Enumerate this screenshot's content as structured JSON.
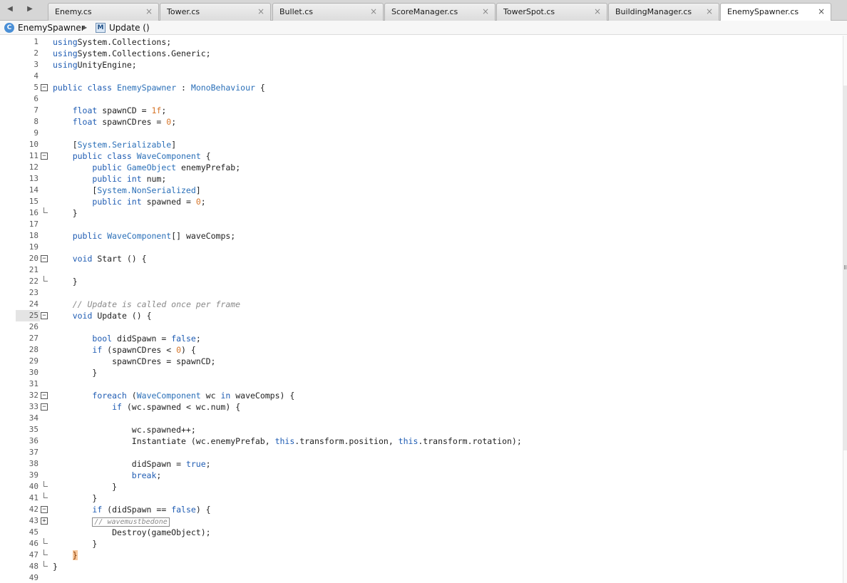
{
  "tabs": [
    {
      "label": "Enemy.cs",
      "close": "×"
    },
    {
      "label": "Tower.cs",
      "close": "×"
    },
    {
      "label": "Bullet.cs",
      "close": "×"
    },
    {
      "label": "ScoreManager.cs",
      "close": "×"
    },
    {
      "label": "TowerSpot.cs",
      "close": "×"
    },
    {
      "label": "BuildingManager.cs",
      "close": "×"
    },
    {
      "label": "EnemySpawner.cs",
      "close": "×"
    }
  ],
  "active_tab_index": 6,
  "nav": {
    "back_icon": "◀",
    "forward_icon": "▶",
    "class_name": "EnemySpawner",
    "class_icon": "C",
    "separator": "▶",
    "method_icon": "M",
    "method_name": "Update ()"
  },
  "editor": {
    "current_line": 25,
    "lines": [
      {
        "n": "1",
        "fold": "",
        "tokens": [
          [
            "kw",
            "using"
          ],
          [
            "",
            "System.Collections;"
          ]
        ]
      },
      {
        "n": "2",
        "fold": "",
        "tokens": [
          [
            "kw",
            "using"
          ],
          [
            "",
            "System.Collections.Generic;"
          ]
        ]
      },
      {
        "n": "3",
        "fold": "",
        "tokens": [
          [
            "kw",
            "using"
          ],
          [
            "",
            "UnityEngine;"
          ]
        ]
      },
      {
        "n": "4",
        "fold": "",
        "tokens": []
      },
      {
        "n": "5",
        "fold": "open",
        "tokens": [
          [
            "kw",
            "public class"
          ],
          [
            "",
            " "
          ],
          [
            "ty",
            "EnemySpawner"
          ],
          [
            "",
            " : "
          ],
          [
            "ty",
            "MonoBehaviour"
          ],
          [
            "",
            " {"
          ]
        ]
      },
      {
        "n": "6",
        "fold": "",
        "tokens": []
      },
      {
        "n": "7",
        "fold": "",
        "tokens": [
          [
            "",
            "    "
          ],
          [
            "kw",
            "float"
          ],
          [
            "",
            " spawnCD = "
          ],
          [
            "num",
            "1f"
          ],
          [
            "",
            ";"
          ]
        ]
      },
      {
        "n": "8",
        "fold": "",
        "tokens": [
          [
            "",
            "    "
          ],
          [
            "kw",
            "float"
          ],
          [
            "",
            " spawnCDres = "
          ],
          [
            "num",
            "0"
          ],
          [
            "",
            ";"
          ]
        ]
      },
      {
        "n": "9",
        "fold": "",
        "tokens": []
      },
      {
        "n": "10",
        "fold": "",
        "tokens": [
          [
            "",
            "    ["
          ],
          [
            "ty",
            "System.Serializable"
          ],
          [
            "",
            "]"
          ]
        ]
      },
      {
        "n": "11",
        "fold": "open",
        "tokens": [
          [
            "",
            "    "
          ],
          [
            "kw",
            "public class"
          ],
          [
            "",
            " "
          ],
          [
            "ty",
            "WaveComponent"
          ],
          [
            "",
            " {"
          ]
        ]
      },
      {
        "n": "12",
        "fold": "",
        "tokens": [
          [
            "",
            "        "
          ],
          [
            "kw",
            "public"
          ],
          [
            "",
            " "
          ],
          [
            "ty",
            "GameObject"
          ],
          [
            "",
            " enemyPrefab;"
          ]
        ]
      },
      {
        "n": "13",
        "fold": "",
        "tokens": [
          [
            "",
            "        "
          ],
          [
            "kw",
            "public int"
          ],
          [
            "",
            " num;"
          ]
        ]
      },
      {
        "n": "14",
        "fold": "",
        "tokens": [
          [
            "",
            "        ["
          ],
          [
            "ty",
            "System.NonSerialized"
          ],
          [
            "",
            "]"
          ]
        ]
      },
      {
        "n": "15",
        "fold": "",
        "tokens": [
          [
            "",
            "        "
          ],
          [
            "kw",
            "public int"
          ],
          [
            "",
            " spawned = "
          ],
          [
            "num",
            "0"
          ],
          [
            "",
            ";"
          ]
        ]
      },
      {
        "n": "16",
        "fold": "end",
        "tokens": [
          [
            "",
            "    }"
          ]
        ]
      },
      {
        "n": "17",
        "fold": "",
        "tokens": []
      },
      {
        "n": "18",
        "fold": "",
        "tokens": [
          [
            "",
            "    "
          ],
          [
            "kw",
            "public"
          ],
          [
            "",
            " "
          ],
          [
            "ty",
            "WaveComponent"
          ],
          [
            "",
            "[] waveComps;"
          ]
        ]
      },
      {
        "n": "19",
        "fold": "",
        "tokens": []
      },
      {
        "n": "20",
        "fold": "open",
        "tokens": [
          [
            "",
            "    "
          ],
          [
            "kw",
            "void"
          ],
          [
            "",
            " Start () {"
          ]
        ]
      },
      {
        "n": "21",
        "fold": "",
        "tokens": []
      },
      {
        "n": "22",
        "fold": "end",
        "tokens": [
          [
            "",
            "    }"
          ]
        ]
      },
      {
        "n": "23",
        "fold": "",
        "tokens": []
      },
      {
        "n": "24",
        "fold": "",
        "tokens": [
          [
            "",
            "    "
          ],
          [
            "cm",
            "// Update is called once per frame"
          ]
        ]
      },
      {
        "n": "25",
        "fold": "open",
        "tokens": [
          [
            "",
            "    "
          ],
          [
            "kw",
            "void"
          ],
          [
            "",
            " Update () {"
          ]
        ]
      },
      {
        "n": "26",
        "fold": "",
        "tokens": []
      },
      {
        "n": "27",
        "fold": "",
        "tokens": [
          [
            "",
            "        "
          ],
          [
            "kw",
            "bool"
          ],
          [
            "",
            " didSpawn = "
          ],
          [
            "kw",
            "false"
          ],
          [
            "",
            ";"
          ]
        ]
      },
      {
        "n": "28",
        "fold": "",
        "tokens": [
          [
            "",
            "        "
          ],
          [
            "kw",
            "if"
          ],
          [
            "",
            " (spawnCDres < "
          ],
          [
            "num",
            "0"
          ],
          [
            "",
            ") {"
          ]
        ]
      },
      {
        "n": "29",
        "fold": "",
        "tokens": [
          [
            "",
            "            spawnCDres = spawnCD;"
          ]
        ]
      },
      {
        "n": "30",
        "fold": "",
        "tokens": [
          [
            "",
            "        }"
          ]
        ]
      },
      {
        "n": "31",
        "fold": "",
        "tokens": []
      },
      {
        "n": "32",
        "fold": "open",
        "tokens": [
          [
            "",
            "        "
          ],
          [
            "kw",
            "foreach"
          ],
          [
            "",
            " ("
          ],
          [
            "ty",
            "WaveComponent"
          ],
          [
            "",
            " wc "
          ],
          [
            "kw",
            "in"
          ],
          [
            "",
            " waveComps) {"
          ]
        ]
      },
      {
        "n": "33",
        "fold": "open",
        "tokens": [
          [
            "",
            "            "
          ],
          [
            "kw",
            "if"
          ],
          [
            "",
            " (wc.spawned < wc.num) {"
          ]
        ]
      },
      {
        "n": "34",
        "fold": "",
        "tokens": []
      },
      {
        "n": "35",
        "fold": "",
        "tokens": [
          [
            "",
            "                wc.spawned++;"
          ]
        ]
      },
      {
        "n": "36",
        "fold": "",
        "tokens": [
          [
            "",
            "                Instantiate (wc.enemyPrefab, "
          ],
          [
            "kw",
            "this"
          ],
          [
            "",
            ".transform.position, "
          ],
          [
            "kw",
            "this"
          ],
          [
            "",
            ".transform.rotation);"
          ]
        ]
      },
      {
        "n": "37",
        "fold": "",
        "tokens": []
      },
      {
        "n": "38",
        "fold": "",
        "tokens": [
          [
            "",
            "                didSpawn = "
          ],
          [
            "kw",
            "true"
          ],
          [
            "",
            ";"
          ]
        ]
      },
      {
        "n": "39",
        "fold": "",
        "tokens": [
          [
            "",
            "                "
          ],
          [
            "kw",
            "break"
          ],
          [
            "",
            ";"
          ]
        ]
      },
      {
        "n": "40",
        "fold": "end",
        "tokens": [
          [
            "",
            "            }"
          ]
        ]
      },
      {
        "n": "41",
        "fold": "end",
        "tokens": [
          [
            "",
            "        }"
          ]
        ]
      },
      {
        "n": "42",
        "fold": "open",
        "tokens": [
          [
            "",
            "        "
          ],
          [
            "kw",
            "if"
          ],
          [
            "",
            " (didSpawn == "
          ],
          [
            "kw",
            "false"
          ],
          [
            "",
            ") {"
          ]
        ]
      },
      {
        "n": "43",
        "fold": "closed",
        "tokens": [
          [
            "",
            "        "
          ],
          [
            "collapsed",
            "// wavemustbedone"
          ]
        ]
      },
      {
        "n": "45",
        "fold": "",
        "tokens": [
          [
            "",
            "            Destroy(gameObject);"
          ]
        ]
      },
      {
        "n": "46",
        "fold": "end",
        "tokens": [
          [
            "",
            "        }"
          ]
        ]
      },
      {
        "n": "47",
        "fold": "end",
        "tokens": [
          [
            "",
            "    "
          ],
          [
            "brace-hl",
            "}"
          ]
        ]
      },
      {
        "n": "48",
        "fold": "end",
        "tokens": [
          [
            "",
            "}"
          ]
        ]
      },
      {
        "n": "49",
        "fold": "",
        "tokens": []
      }
    ]
  }
}
